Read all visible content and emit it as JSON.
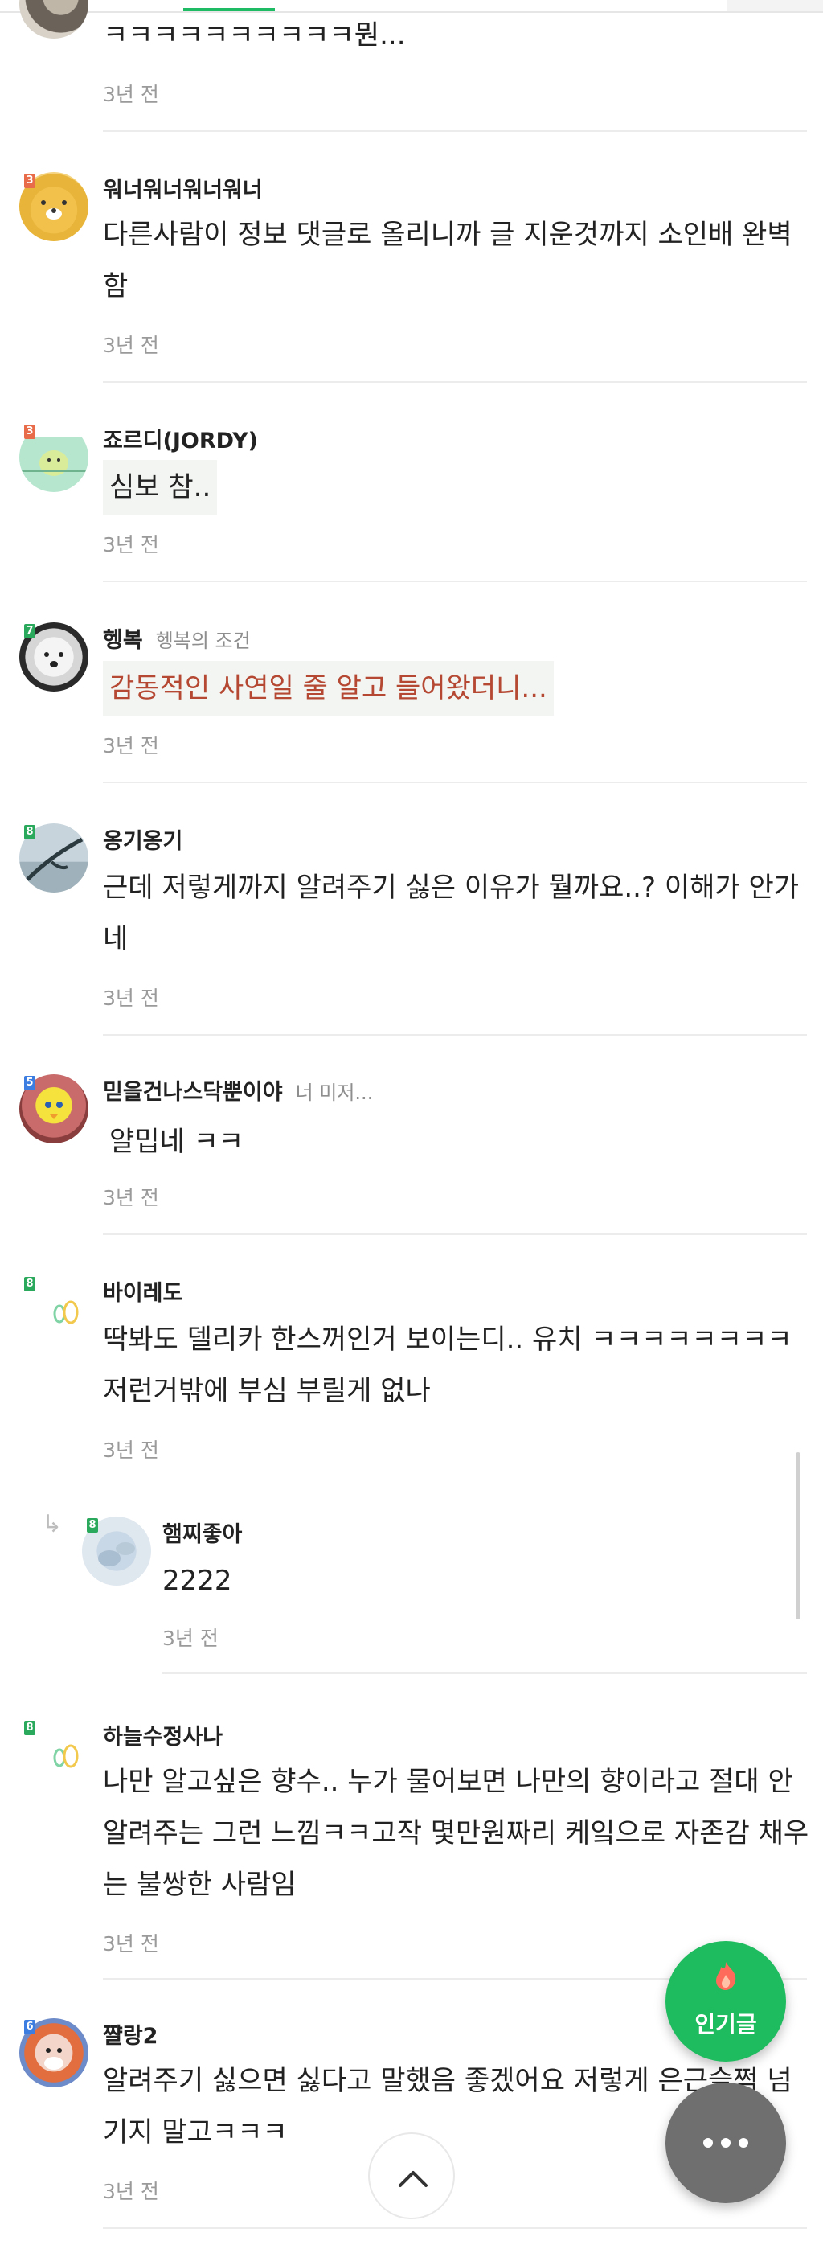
{
  "comments": [
    {
      "nickname": "",
      "tag": "",
      "text": "ㅋㅋㅋㅋㅋㅋㅋㅋㅋㅋ뭔...",
      "time": "3년 전"
    },
    {
      "nickname": "워너워너워너워너",
      "tag": "",
      "level": "3",
      "text": "다른사람이 정보 댓글로 올리니까 글 지운것까지 소인배 완벽함",
      "time": "3년 전"
    },
    {
      "nickname": "죠르디(JORDY)",
      "tag": "",
      "level": "3",
      "text": "심보 참..",
      "time": "3년 전"
    },
    {
      "nickname": "헹복",
      "tag": "헹복의 조건",
      "level": "7",
      "text": "감동적인 사연일 줄 알고 들어왔더니...",
      "time": "3년 전"
    },
    {
      "nickname": "옹기옹기",
      "tag": "",
      "level": "8",
      "text": "근데 저렇게까지 알려주기 싫은 이유가 뭘까요..? 이해가 안가네",
      "time": "3년 전"
    },
    {
      "nickname": "믿을건나스닥뿐이야",
      "tag": "너 미저...",
      "level": "5",
      "text": "얄밉네 ㅋㅋ",
      "time": "3년 전"
    },
    {
      "nickname": "바이레도",
      "tag": "",
      "level": "8",
      "text": "딱봐도 델리카 한스꺼인거 보이는디.. 유치 ㅋㅋㅋㅋㅋㅋㅋㅋ 저런거밖에 부심 부릴게 없나",
      "time": "3년 전"
    },
    {
      "nickname": "햄찌좋아",
      "tag": "",
      "level": "8",
      "text": "2222",
      "time": "3년 전",
      "reply": true
    },
    {
      "nickname": "하늘수정사나",
      "tag": "",
      "level": "8",
      "text": "나만 알고싶은 향수.. 누가 물어보면 나만의 향이라고 절대 안 알려주는 그런 느낌ㅋㅋ고작 몇만원짜리 케잌으로 자존감 채우는 불쌍한 사람임",
      "time": "3년 전"
    },
    {
      "nickname": "쨜랑2",
      "tag": "",
      "level": "6",
      "text": "알려주기 싫으면 싫다고 말했음 좋겠어요 저렇게 은근슬쩍 넘기지 말고ㅋㅋㅋ",
      "time": "3년 전"
    }
  ],
  "buttons": {
    "popular_label": "인기글"
  },
  "icons": {
    "popular": "flame-icon",
    "more": "more-dots-icon",
    "top": "chevron-up-icon",
    "reply": "reply-arrow-icon"
  },
  "colors": {
    "accent": "#1ebc5e",
    "highlight_text": "#b54832",
    "more_button": "#6f6f6f"
  }
}
